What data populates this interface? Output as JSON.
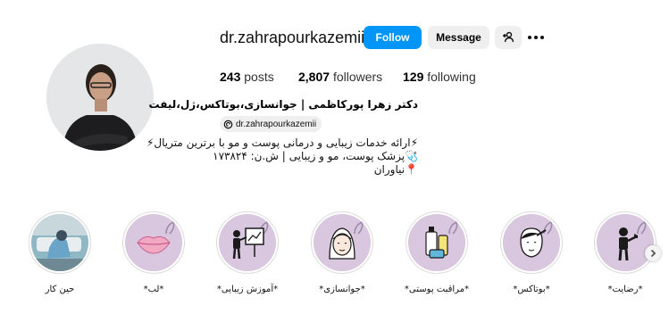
{
  "profile": {
    "username": "dr.zahrapourkazemii",
    "follow_label": "Follow",
    "message_label": "Message",
    "add_user_icon": "add-user-icon",
    "more_icon": "more-dots-icon",
    "accent": "#0095f6"
  },
  "stats": {
    "posts_count": "243",
    "posts_label": "posts",
    "followers_count": "2,807",
    "followers_label": "followers",
    "following_count": "129",
    "following_label": "following"
  },
  "bio": {
    "name": "دکتر زهرا پورکاظمی | جوانسازی،بوتاکس،ژل،لیفت",
    "threads_handle": "dr.zahrapourkazemii",
    "line1": "⚡ارائه خدمات زیبایی و درمانی پوست و مو با برترین متریال⚡",
    "line2": "🩺پزشک پوست، مو و زیبایی | ش.ن: ۱۷۳۸۲۴",
    "line3": "📍نیاوران"
  },
  "highlights": [
    {
      "label": "حین کار",
      "icon": "clinic-photo"
    },
    {
      "label": "*لب*",
      "icon": "lips-icon"
    },
    {
      "label": "*آموزش زیبایی*",
      "icon": "teacher-board-icon"
    },
    {
      "label": "*جوانسازی*",
      "icon": "woman-face-icon"
    },
    {
      "label": "*مراقبت پوستی*",
      "icon": "skincare-bottles-icon"
    },
    {
      "label": "*بوتاکس*",
      "icon": "injection-face-icon"
    },
    {
      "label": "*رضایت*",
      "icon": "thumbs-up-person-icon"
    }
  ],
  "colors": {
    "highlight_bg": "#d9c7df",
    "icon_dark": "#1a1a1a"
  }
}
